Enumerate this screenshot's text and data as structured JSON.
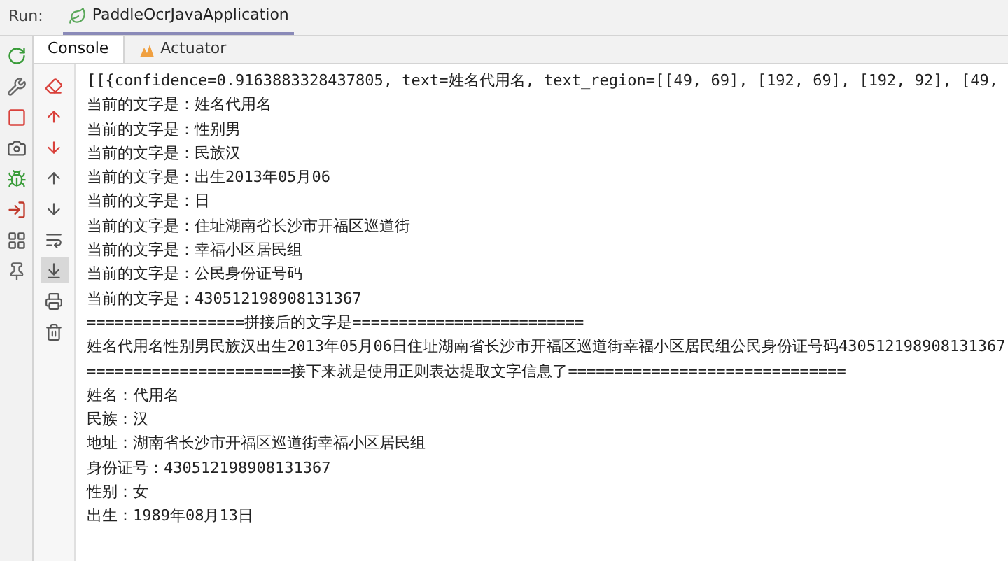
{
  "run_bar": {
    "label": "Run:",
    "tab": {
      "label": "PaddleOcrJavaApplication",
      "selected": true
    }
  },
  "tabs": [
    {
      "label": "Console",
      "kind": "console",
      "selected": true
    },
    {
      "label": "Actuator",
      "kind": "actuator",
      "selected": false
    }
  ],
  "run_toolbar": [
    {
      "kind": "rerun"
    },
    {
      "kind": "wrench"
    },
    {
      "kind": "stop"
    },
    {
      "kind": "camera"
    },
    {
      "kind": "debug"
    },
    {
      "kind": "exit"
    },
    {
      "kind": "layout"
    },
    {
      "kind": "pin"
    }
  ],
  "console_toolbar": [
    {
      "kind": "clear",
      "selected": false
    },
    {
      "kind": "up-red",
      "selected": false
    },
    {
      "kind": "down-red",
      "selected": false
    },
    {
      "kind": "up",
      "selected": false
    },
    {
      "kind": "down",
      "selected": false
    },
    {
      "kind": "wrap",
      "selected": false
    },
    {
      "kind": "scroll-end",
      "selected": true
    },
    {
      "kind": "print",
      "selected": false
    },
    {
      "kind": "trash",
      "selected": false
    }
  ],
  "console": {
    "lines": [
      "[[{confidence=0.9163883328437805, text=姓名代用名, text_region=[[49, 69], [192, 69], [192, 92], [49, ",
      "当前的文字是：姓名代用名",
      "当前的文字是：性别男",
      "当前的文字是：民族汉",
      "当前的文字是：出生2013年05月06",
      "当前的文字是：日",
      "当前的文字是：住址湖南省长沙市开福区巡道街",
      "当前的文字是：幸福小区居民组",
      "当前的文字是：公民身份证号码",
      "当前的文字是：430512198908131367",
      "=================拼接后的文字是=========================",
      "姓名代用名性别男民族汉出生2013年05月06日住址湖南省长沙市开福区巡道街幸福小区居民组公民身份证号码430512198908131367",
      "======================接下来就是使用正则表达提取文字信息了==============================",
      "姓名：代用名",
      "民族：汉",
      "地址：湖南省长沙市开福区巡道街幸福小区居民组",
      "身份证号：430512198908131367",
      "性别：女",
      "出生：1989年08月13日"
    ]
  }
}
